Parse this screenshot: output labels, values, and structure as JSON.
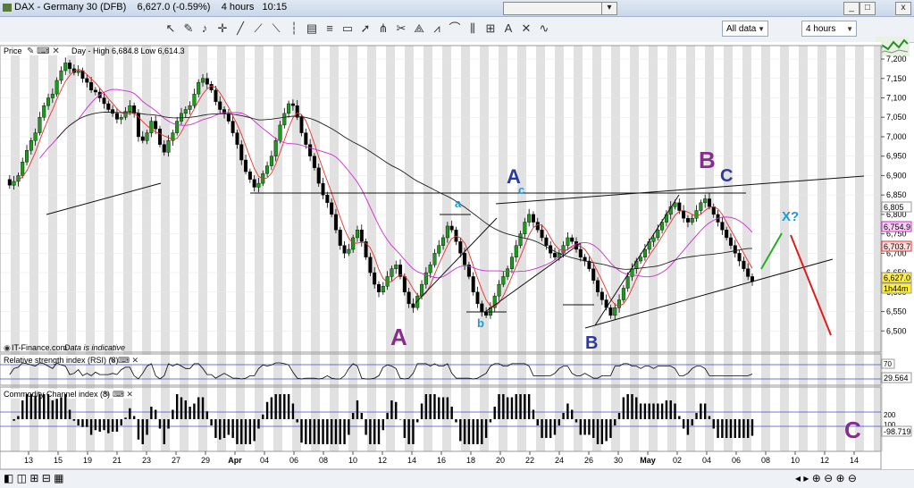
{
  "window": {
    "title": "DAX - Germany 30 (DFB)    6,627.0 (-0.59%)    4 hours   10:15",
    "buttons": {
      "minimize": "_",
      "maximize": "□",
      "close": "x"
    }
  },
  "toolbar": {
    "data_range": "All data",
    "interval": "4 hours"
  },
  "price_panel": {
    "label": "Price",
    "header_info": "Day - High 6,684.8 Low 6,614.3",
    "footer_note_source": "IT-Finance.com",
    "footer_note_text": "Data is indicative",
    "price_badges": {
      "ma1": "6,805",
      "ma2": "6,754.9",
      "ma3": "6,703.7",
      "last": "6,627.0",
      "countdown": "1h44m"
    },
    "colors": {
      "up": "#1c9a1c",
      "down": "#000000",
      "ma_fast": "#e8322a",
      "ma_mid": "#d02bd0",
      "ma_slow": "#222222",
      "weekend": "#c8c8c8"
    }
  },
  "annotations": {
    "A_main": "A",
    "a_small": "a",
    "b_small": "b",
    "A_blue": "A",
    "c_small": "c",
    "B_blue": "B",
    "B_purple": "B",
    "C_blue": "C",
    "X_q": "X?",
    "C_purple": "C"
  },
  "rsi_panel": {
    "label": "Relative strength index (RSI) (8)",
    "level_high": "70",
    "value": "29.564"
  },
  "cci_panel": {
    "label": "Commodity Channel index (8)",
    "level_high": "200",
    "level_mid": "100",
    "value": "-98.719"
  },
  "x_axis": {
    "labels": [
      "13",
      "15",
      "19",
      "21",
      "23",
      "27",
      "29",
      "Apr",
      "04",
      "06",
      "08",
      "10",
      "12",
      "14",
      "16",
      "18",
      "20",
      "22",
      "24",
      "26",
      "30",
      "May",
      "02",
      "04",
      "06",
      "08",
      "10",
      "12",
      "14"
    ]
  },
  "chart_data": {
    "type": "line",
    "title": "DAX - Germany 30 (DFB)",
    "ylabel": "",
    "xlabel": "",
    "ylim": [
      6450,
      7230
    ],
    "y_ticks": [
      7200,
      7150,
      7100,
      7050,
      7000,
      6950,
      6900,
      6850,
      6800,
      6750,
      6700,
      6650,
      6600,
      6550,
      6500
    ],
    "y_tick_labels": [
      "7,200",
      "7,150",
      "7,100",
      "7,050",
      "7,000",
      "6,950",
      "6,900",
      "6,850",
      "6,800",
      "6,750",
      "6,700",
      "6,650",
      "6,600",
      "6,550",
      "6,500"
    ],
    "series": [
      {
        "values": [
          6890,
          6875,
          6885,
          6900,
          6935,
          6965,
          6990,
          7010,
          7050,
          7080,
          7100,
          7110,
          7145,
          7170,
          7190,
          7175,
          7165,
          7170,
          7150,
          7140,
          7120,
          7115,
          7100,
          7085,
          7070,
          7060,
          7045,
          7050,
          7065,
          7080,
          7060,
          7000,
          6990,
          7010,
          7040,
          7020,
          6980,
          6960,
          6990,
          7010,
          7040,
          7060,
          7070,
          7080,
          7110,
          7140,
          7150,
          7135,
          7120,
          7090,
          7070,
          7060,
          7040,
          7010,
          6980,
          6940,
          6910,
          6890,
          6870,
          6880,
          6905,
          6925,
          6950,
          6990,
          7030,
          7060,
          7085,
          7080,
          7050,
          7010,
          6980,
          6950,
          6920,
          6880,
          6850,
          6830,
          6800,
          6760,
          6720,
          6700,
          6710,
          6740,
          6760,
          6730,
          6690,
          6650,
          6620,
          6600,
          6615,
          6640,
          6660,
          6670,
          6640,
          6600,
          6570,
          6560,
          6590,
          6620,
          6650,
          6670,
          6700,
          6720,
          6740,
          6770,
          6760,
          6730,
          6700,
          6670,
          6640,
          6600,
          6570,
          6550,
          6540,
          6560,
          6590,
          6620,
          6640,
          6660,
          6690,
          6720,
          6750,
          6780,
          6800,
          6780,
          6760,
          6740,
          6720,
          6700,
          6690,
          6700,
          6720,
          6740,
          6730,
          6710,
          6690,
          6680,
          6660,
          6630,
          6600,
          6580,
          6560,
          6540,
          6560,
          6580,
          6610,
          6640,
          6660,
          6680,
          6690,
          6710,
          6730,
          6740,
          6760,
          6780,
          6800,
          6820,
          6830,
          6810,
          6790,
          6780,
          6790,
          6810,
          6830,
          6840,
          6820,
          6800,
          6780,
          6760,
          6740,
          6720,
          6700,
          6680,
          6660,
          6640,
          6627
        ],
        "start_label": "13",
        "end_label": "04"
      }
    ]
  }
}
